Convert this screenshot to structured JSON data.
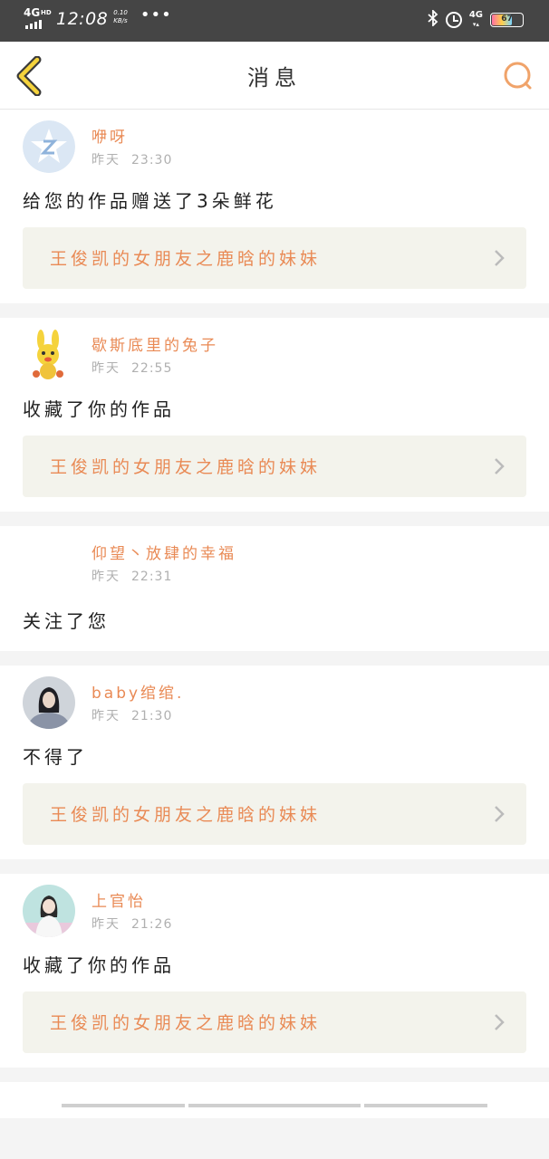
{
  "status_bar": {
    "network": "4G",
    "network_suffix": "HD",
    "time": "12:08",
    "speed_value": "0.10",
    "speed_unit": "KB/s",
    "more": "•••",
    "bluetooth_icon": "bluetooth-icon",
    "alarm_icon": "alarm-icon",
    "mobile_data": "4G",
    "battery": "67"
  },
  "header": {
    "title": "消息",
    "back_icon": "chevron-left-icon",
    "search_icon": "search-icon",
    "accent_color": "#e98a55"
  },
  "messages": [
    {
      "name": "咿呀",
      "day": "昨天",
      "time": "23:30",
      "action": "给您的作品赠送了3朵鲜花",
      "work": "王俊凯的女朋友之鹿晗的妹妹"
    },
    {
      "name": "歇斯底里的兔子",
      "day": "昨天",
      "time": "22:55",
      "action": "收藏了你的作品",
      "work": "王俊凯的女朋友之鹿晗的妹妹"
    },
    {
      "name": "仰望丶放肆的幸福",
      "day": "昨天",
      "time": "22:31",
      "action": "关注了您"
    },
    {
      "name": "baby绾绾.",
      "day": "昨天",
      "time": "21:30",
      "action": "不得了",
      "work": "王俊凯的女朋友之鹿晗的妹妹"
    },
    {
      "name": "上官怡",
      "day": "昨天",
      "time": "21:26",
      "action": "收藏了你的作品",
      "work": "王俊凯的女朋友之鹿晗的妹妹"
    }
  ]
}
